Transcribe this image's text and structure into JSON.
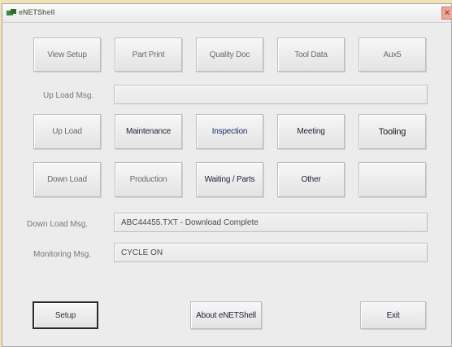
{
  "window": {
    "title": "eNETShell",
    "close_label": "×"
  },
  "row1": [
    "View Setup",
    "Part Print",
    "Quality Doc",
    "Tool Data",
    "Aux5"
  ],
  "row2": [
    "Up Load",
    "Maintenance",
    "Inspection",
    "Meeting",
    "Tooling"
  ],
  "row3": [
    "Down Load",
    "Production",
    "Waiting / Parts",
    "Other",
    ""
  ],
  "messages": {
    "upload_label": "Up Load Msg.",
    "upload_value": "",
    "download_label": "Down Load Msg.",
    "download_value": "ABC44455.TXT  -  Download Complete",
    "monitoring_label": "Monitoring Msg.",
    "monitoring_value": "CYCLE ON"
  },
  "bottom": {
    "setup": "Setup",
    "about": "About eNETShell",
    "exit": "Exit"
  },
  "colors": {
    "background": "#f1e3b3",
    "window": "#ececec",
    "close": "#d35b4c"
  }
}
